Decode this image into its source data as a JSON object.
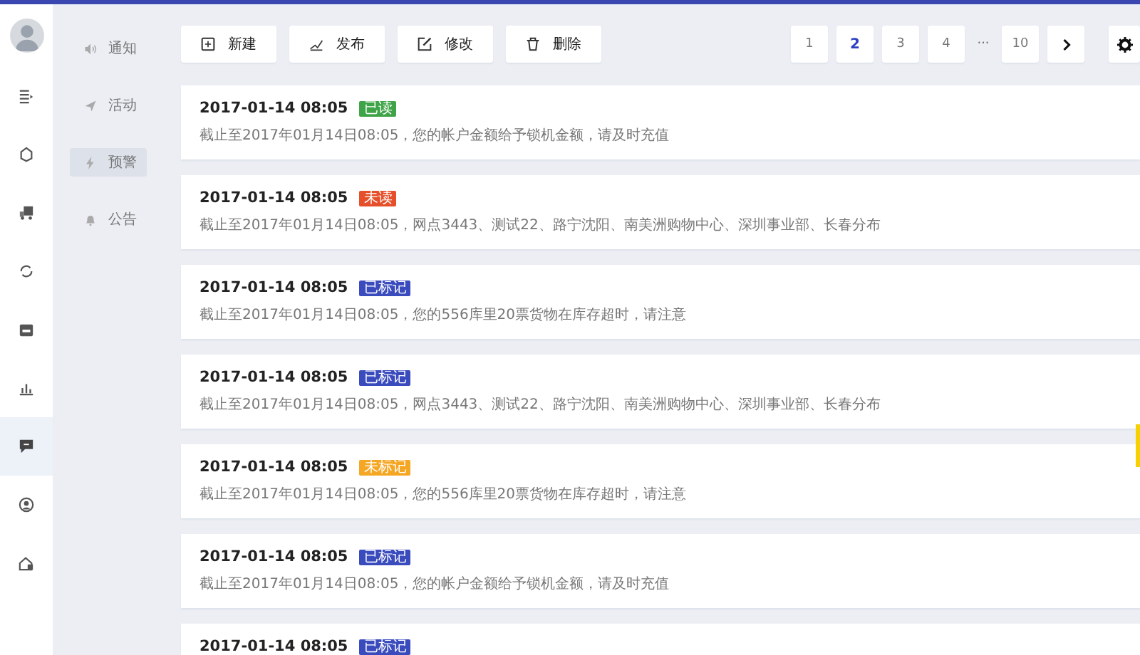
{
  "rail": [
    {
      "selected": false
    },
    {
      "selected": false
    },
    {
      "selected": false
    },
    {
      "selected": false
    },
    {
      "selected": false
    },
    {
      "selected": false
    },
    {
      "selected": true
    },
    {
      "selected": false
    },
    {
      "selected": false
    }
  ],
  "subnav": [
    {
      "label": "通知",
      "selected": false
    },
    {
      "label": "活动",
      "selected": false
    },
    {
      "label": "预警",
      "selected": true
    },
    {
      "label": "公告",
      "selected": false
    }
  ],
  "toolbar": [
    {
      "label": "新建"
    },
    {
      "label": "发布"
    },
    {
      "label": "修改"
    },
    {
      "label": "删除"
    }
  ],
  "pagination": [
    {
      "kind": "page",
      "label": "1",
      "selected": false
    },
    {
      "kind": "page",
      "label": "2",
      "selected": true
    },
    {
      "kind": "page",
      "label": "3",
      "selected": false
    },
    {
      "kind": "page",
      "label": "4",
      "selected": false
    },
    {
      "kind": "ellipsis",
      "label": "···"
    },
    {
      "kind": "page",
      "label": "10",
      "selected": false
    },
    {
      "kind": "next"
    }
  ],
  "messages": [
    {
      "time": "2017-01-14 08:05",
      "tag": "已读",
      "color": "#3fa447",
      "text": "截止至2017年01月14日08:05，您的帐户金额给予锁机金额，请及时充值"
    },
    {
      "time": "2017-01-14 08:05",
      "tag": "未读",
      "color": "#e5502b",
      "text": "截止至2017年01月14日08:05，网点3443、测试22、路宁沈阳、南美洲购物中心、深圳事业部、长春分布"
    },
    {
      "time": "2017-01-14 08:05",
      "tag": "已标记",
      "color": "#3a4bbd",
      "text": "截止至2017年01月14日08:05，您的556库里20票货物在库存超时，请注意"
    },
    {
      "time": "2017-01-14 08:05",
      "tag": "已标记",
      "color": "#3a4bbd",
      "text": "截止至2017年01月14日08:05，网点3443、测试22、路宁沈阳、南美洲购物中心、深圳事业部、长春分布"
    },
    {
      "time": "2017-01-14 08:05",
      "tag": "未标记",
      "color": "#f5a623",
      "text": "截止至2017年01月14日08:05，您的556库里20票货物在库存超时，请注意"
    },
    {
      "time": "2017-01-14 08:05",
      "tag": "已标记",
      "color": "#3a4bbd",
      "text": "截止至2017年01月14日08:05，您的帐户金额给予锁机金额，请及时充值"
    },
    {
      "time": "2017-01-14 08:05",
      "tag": "已标记",
      "color": "#3a4bbd"
    }
  ]
}
